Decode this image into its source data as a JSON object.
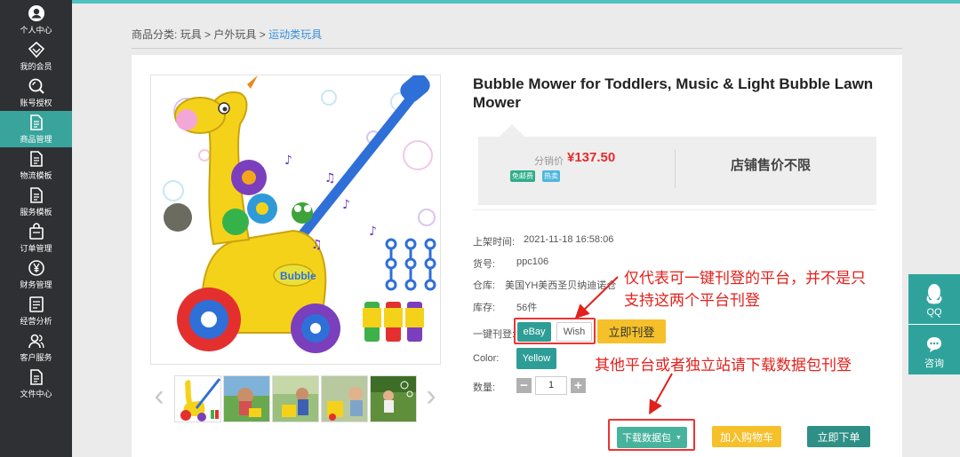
{
  "sidebar": {
    "items": [
      {
        "label": "个人中心",
        "icon": "user-icon"
      },
      {
        "label": "我的会员",
        "icon": "diamond-icon"
      },
      {
        "label": "账号授权",
        "icon": "search-icon"
      },
      {
        "label": "商品管理",
        "icon": "document-icon",
        "active": true
      },
      {
        "label": "物流模板",
        "icon": "document-icon"
      },
      {
        "label": "服务模板",
        "icon": "document-icon"
      },
      {
        "label": "订单管理",
        "icon": "bag-icon"
      },
      {
        "label": "财务管理",
        "icon": "yen-icon"
      },
      {
        "label": "经营分析",
        "icon": "chart-doc-icon"
      },
      {
        "label": "客户服务",
        "icon": "people-icon"
      },
      {
        "label": "文件中心",
        "icon": "document-icon"
      }
    ]
  },
  "breadcrumb": {
    "prefix": "商品分类:",
    "level1": "玩具",
    "sep": ">",
    "level2": "户外玩具",
    "level3": "运动类玩具"
  },
  "product": {
    "title": "Bubble Mower for Toddlers, Music & Light Bubble Lawn Mower",
    "price_label": "分销价",
    "price": "¥137.50",
    "badges": [
      {
        "text": "免邮费",
        "color": "#2fae8b"
      },
      {
        "text": "热卖",
        "color": "#4fb6e0"
      }
    ],
    "store_price_text": "店铺售价不限",
    "listed_label": "上架时间:",
    "listed_value": "2021-11-18 16:58:06",
    "sku_label": "货号:",
    "sku_value": "ppc106",
    "warehouse_label": "仓库:",
    "warehouse_value": "美国YH美西圣贝纳迪诺仓",
    "stock_label": "库存:",
    "stock_value": "56件",
    "publish_label": "一键刊登:",
    "platforms": [
      "eBay",
      "Wish"
    ],
    "publish_button": "立即刊登",
    "color_label": "Color:",
    "color_value": "Yellow",
    "qty_label": "数量:",
    "qty_value": "1",
    "minus": "−",
    "plus": "+",
    "download_button": "下载数据包",
    "cart_button": "加入购物车",
    "order_button": "立即下单"
  },
  "annotations": {
    "line1": "仅代表可一键刊登的平台，并不是只",
    "line2": "支持这两个平台刊登",
    "line3": "其他平台或者独立站请下载数据包刊登"
  },
  "float": {
    "qq": "QQ",
    "consult": "咨询"
  },
  "colors": {
    "accent": "#2e9d96",
    "sidebar_bg": "#2f3033",
    "price_red": "#e52c2c",
    "yellow": "#f5c02a",
    "annotation_red": "#e2211c"
  }
}
